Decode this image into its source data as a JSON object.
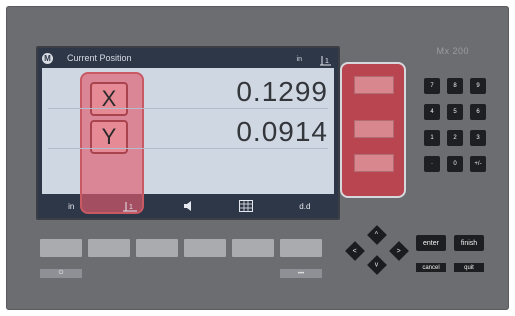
{
  "device": {
    "model": "Mx 200"
  },
  "screen": {
    "title": "Current Position",
    "unit": "in",
    "rows": [
      {
        "axis": "X",
        "value": "0.1299"
      },
      {
        "axis": "Y",
        "value": "0.0914"
      }
    ],
    "bottom_bar": {
      "unit": "in",
      "axis_icon_label": "1",
      "format": "d.d"
    }
  },
  "numpad": {
    "keys": [
      "7",
      "8",
      "9",
      "4",
      "5",
      "6",
      "1",
      "2",
      "3",
      "·",
      "0",
      "+/-"
    ]
  },
  "dpad": {
    "up": "^",
    "down": "v",
    "left": "<",
    "right": ">"
  },
  "functions": {
    "enter": "enter",
    "finish": "finish",
    "cancel": "cancel",
    "quit": "quit"
  },
  "small_keys": {
    "left_icon": "⏻",
    "right_dots": "•••"
  }
}
